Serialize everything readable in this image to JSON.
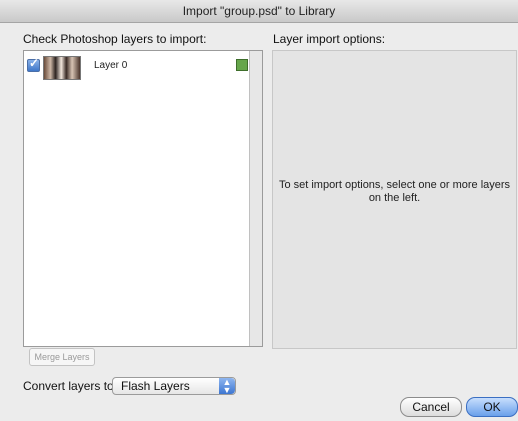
{
  "window": {
    "title": "Import \"group.psd\" to Library"
  },
  "left_panel": {
    "heading": "Check Photoshop layers to import:",
    "layers": [
      {
        "name": "Layer 0",
        "checked": true
      }
    ]
  },
  "right_panel": {
    "heading": "Layer import options:",
    "message": "To set import options, select one or more layers on the left."
  },
  "merge_button": {
    "label": "Merge Layers",
    "enabled": false
  },
  "convert": {
    "label": "Convert layers to:",
    "value": "Flash Layers"
  },
  "buttons": {
    "cancel": "Cancel",
    "ok": "OK"
  }
}
